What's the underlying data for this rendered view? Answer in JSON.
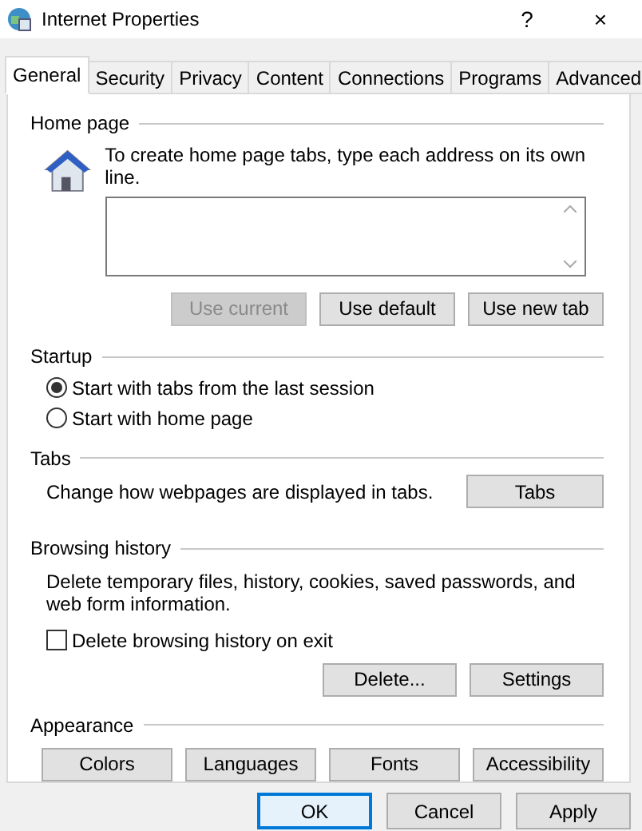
{
  "window": {
    "title": "Internet Properties",
    "help": "?",
    "close": "×"
  },
  "tabs": [
    {
      "label": "General",
      "selected": true
    },
    {
      "label": "Security",
      "selected": false
    },
    {
      "label": "Privacy",
      "selected": false
    },
    {
      "label": "Content",
      "selected": false
    },
    {
      "label": "Connections",
      "selected": false
    },
    {
      "label": "Programs",
      "selected": false
    },
    {
      "label": "Advanced",
      "selected": false
    }
  ],
  "home_page": {
    "heading": "Home page",
    "instruction": "To create home page tabs, type each address on its own line.",
    "buttons": [
      {
        "label": "Use current",
        "disabled": true
      },
      {
        "label": "Use default",
        "disabled": false
      },
      {
        "label": "Use new tab",
        "disabled": false
      }
    ]
  },
  "startup": {
    "heading": "Startup",
    "options": [
      {
        "label": "Start with tabs from the last session",
        "selected": true
      },
      {
        "label": "Start with home page",
        "selected": false
      }
    ]
  },
  "tabs_section": {
    "heading": "Tabs",
    "description": "Change how webpages are displayed in tabs.",
    "button": "Tabs"
  },
  "browsing_history": {
    "heading": "Browsing history",
    "description": "Delete temporary files, history, cookies, saved passwords, and web form information.",
    "checkbox": {
      "label": "Delete browsing history on exit",
      "checked": false
    },
    "buttons": [
      "Delete...",
      "Settings"
    ]
  },
  "appearance": {
    "heading": "Appearance",
    "buttons": [
      "Colors",
      "Languages",
      "Fonts",
      "Accessibility"
    ]
  },
  "dialog_buttons": [
    {
      "label": "OK",
      "default": true
    },
    {
      "label": "Cancel",
      "default": false
    },
    {
      "label": "Apply",
      "default": false
    }
  ]
}
